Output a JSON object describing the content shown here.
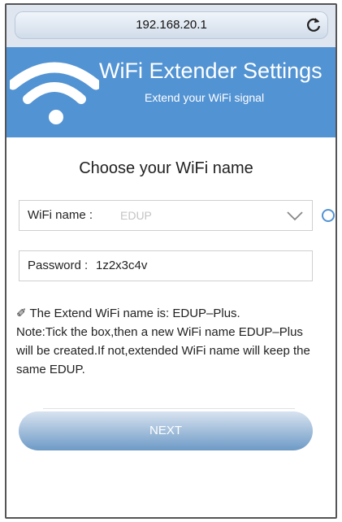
{
  "browser": {
    "url": "192.168.20.1",
    "reload_icon": "reload-icon"
  },
  "header": {
    "title": "WiFi Extender Settings",
    "subtitle": "Extend your WiFi signal",
    "icon": "wifi-icon",
    "background_color": "#5293d3"
  },
  "form": {
    "heading": "Choose your WiFi name",
    "wifi_label": "WiFi name :",
    "wifi_value": "EDUP",
    "password_label": "Password :",
    "password_value": "1z2x3c4v"
  },
  "note": {
    "check_line": "✐ The Extend WiFi name is: EDUP–Plus.",
    "text": "Note:Tick the box,then a new WiFi name EDUP–Plus will be created.If not,extended WiFi name will keep the same EDUP."
  },
  "actions": {
    "next_label": "NEXT"
  }
}
